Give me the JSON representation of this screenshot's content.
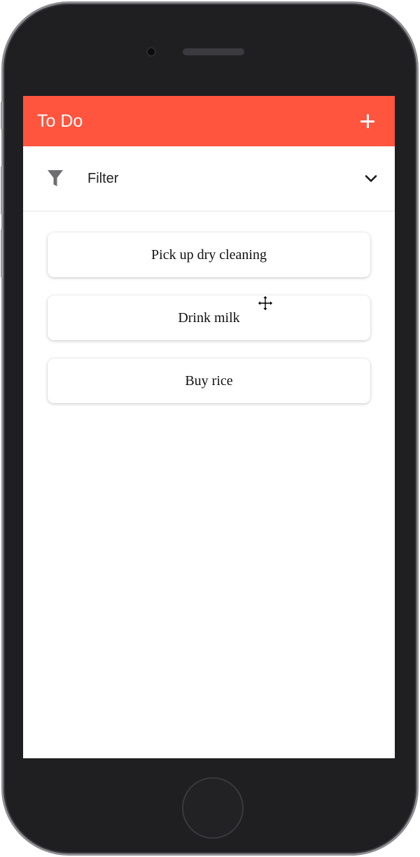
{
  "app": {
    "title": "To Do",
    "add_icon": "plus-icon",
    "accent_color": "#ff553f"
  },
  "filter": {
    "icon": "funnel-icon",
    "label": "Filter",
    "expand_icon": "chevron-down-icon"
  },
  "todos": [
    {
      "text": "Pick up dry cleaning"
    },
    {
      "text": "Drink milk"
    },
    {
      "text": "Buy rice"
    }
  ],
  "cursor": {
    "icon": "move-cursor-icon"
  }
}
